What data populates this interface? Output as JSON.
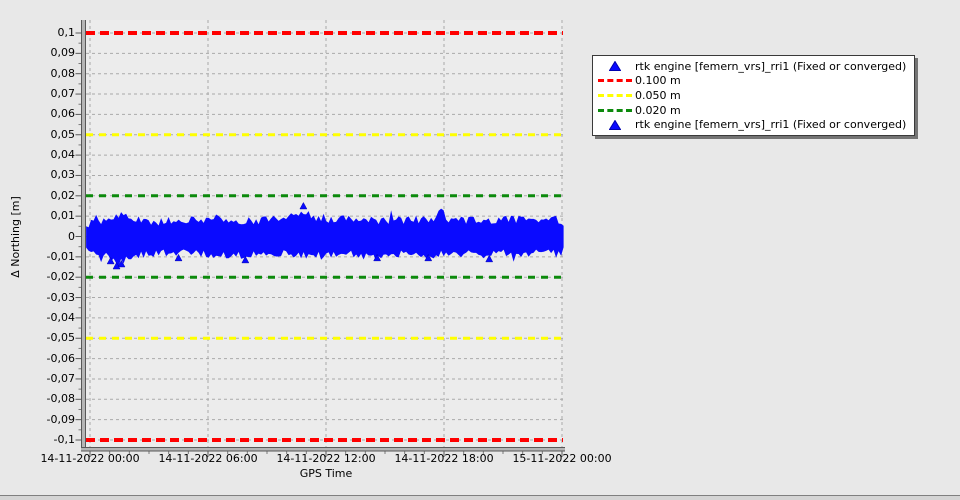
{
  "page": {
    "background": "#e8e8e8"
  },
  "chart_data": {
    "type": "scatter",
    "title": "",
    "xlabel": "GPS Time",
    "ylabel": "Δ Northing [m]",
    "x_tick_labels": [
      "14-11-2022 00:00",
      "14-11-2022 06:00",
      "14-11-2022 12:00",
      "14-11-2022 18:00",
      "15-11-2022 00:00"
    ],
    "x_tick_hours": [
      0,
      6,
      12,
      18,
      24
    ],
    "y_tick_labels": [
      "0,1",
      "0,09",
      "0,08",
      "0,07",
      "0,06",
      "0,05",
      "0,04",
      "0,03",
      "0,02",
      "0,01",
      "0",
      "-0,01",
      "-0,02",
      "-0,03",
      "-0,04",
      "-0,05",
      "-0,06",
      "-0,07",
      "-0,08",
      "-0,09",
      "-0,1"
    ],
    "ylim": [
      -0.105,
      0.105
    ],
    "y_tick_step": 0.01,
    "grid": true,
    "plot_bg": "#ececec",
    "grid_color": "#a9a9a9",
    "thresholds": [
      {
        "value": 0.1,
        "color": "#ff0000",
        "label": "0.100 m"
      },
      {
        "value": -0.1,
        "color": "#ff0000",
        "label": "0.100 m"
      },
      {
        "value": 0.05,
        "color": "#ffff00",
        "label": "0.050 m"
      },
      {
        "value": -0.05,
        "color": "#ffff00",
        "label": "0.050 m"
      },
      {
        "value": 0.02,
        "color": "#0c8a0c",
        "label": "0.020 m"
      },
      {
        "value": -0.02,
        "color": "#0c8a0c",
        "label": "0.020 m"
      }
    ],
    "series": [
      {
        "name": "rtk engine [femern_vrs]_rri1 (Fixed or converged)",
        "marker": "triangle",
        "color": "#0a0aff",
        "edge_color": "#0000b0",
        "x_hours_range": [
          -0.2,
          24.15
        ],
        "envelope": {
          "x_hours": [
            -0.2,
            0,
            0.75,
            1.5,
            2,
            3,
            4,
            5,
            6,
            6.5,
            7,
            8,
            9,
            10,
            10.8,
            11.3,
            12,
            13,
            14,
            15,
            16,
            17,
            18,
            19,
            20,
            21,
            22,
            23,
            24,
            24.15
          ],
          "upper_m": [
            0.004,
            0.006,
            0.007,
            0.0105,
            0.008,
            0.0065,
            0.007,
            0.0075,
            0.008,
            0.009,
            0.0075,
            0.007,
            0.0075,
            0.008,
            0.0125,
            0.009,
            0.0075,
            0.008,
            0.0085,
            0.007,
            0.0075,
            0.008,
            0.0085,
            0.007,
            0.0075,
            0.008,
            0.0075,
            0.008,
            0.0075,
            0.005
          ],
          "lower_m": [
            -0.005,
            -0.007,
            -0.009,
            -0.0125,
            -0.009,
            -0.008,
            -0.0075,
            -0.007,
            -0.0085,
            -0.008,
            -0.0095,
            -0.0085,
            -0.008,
            -0.0075,
            -0.009,
            -0.0085,
            -0.009,
            -0.0075,
            -0.008,
            -0.0085,
            -0.0075,
            -0.008,
            -0.0085,
            -0.008,
            -0.0085,
            -0.0075,
            -0.008,
            -0.0075,
            -0.007,
            -0.005
          ]
        },
        "outliers": [
          {
            "x_hours": 1.05,
            "y_m": -0.012
          },
          {
            "x_hours": 1.35,
            "y_m": -0.0145
          },
          {
            "x_hours": 1.6,
            "y_m": -0.0135
          },
          {
            "x_hours": 4.5,
            "y_m": -0.0105
          },
          {
            "x_hours": 7.9,
            "y_m": -0.0115
          },
          {
            "x_hours": 10.85,
            "y_m": 0.015
          },
          {
            "x_hours": 14.6,
            "y_m": -0.0105
          },
          {
            "x_hours": 17.2,
            "y_m": -0.0105
          },
          {
            "x_hours": 20.3,
            "y_m": -0.011
          }
        ]
      }
    ]
  },
  "legend": {
    "items": [
      {
        "marker": "triangle",
        "color": "#0a0aff",
        "label": "rtk engine [femern_vrs]_rri1 (Fixed or converged)"
      },
      {
        "marker": "dash",
        "color": "#ff0000",
        "label": "0.100 m"
      },
      {
        "marker": "dash",
        "color": "#ffff00",
        "label": "0.050 m"
      },
      {
        "marker": "dash",
        "color": "#0c8a0c",
        "label": "0.020 m"
      },
      {
        "marker": "triangle",
        "color": "#0a0aff",
        "label": "rtk engine [femern_vrs]_rri1 (Fixed or converged)"
      }
    ]
  }
}
